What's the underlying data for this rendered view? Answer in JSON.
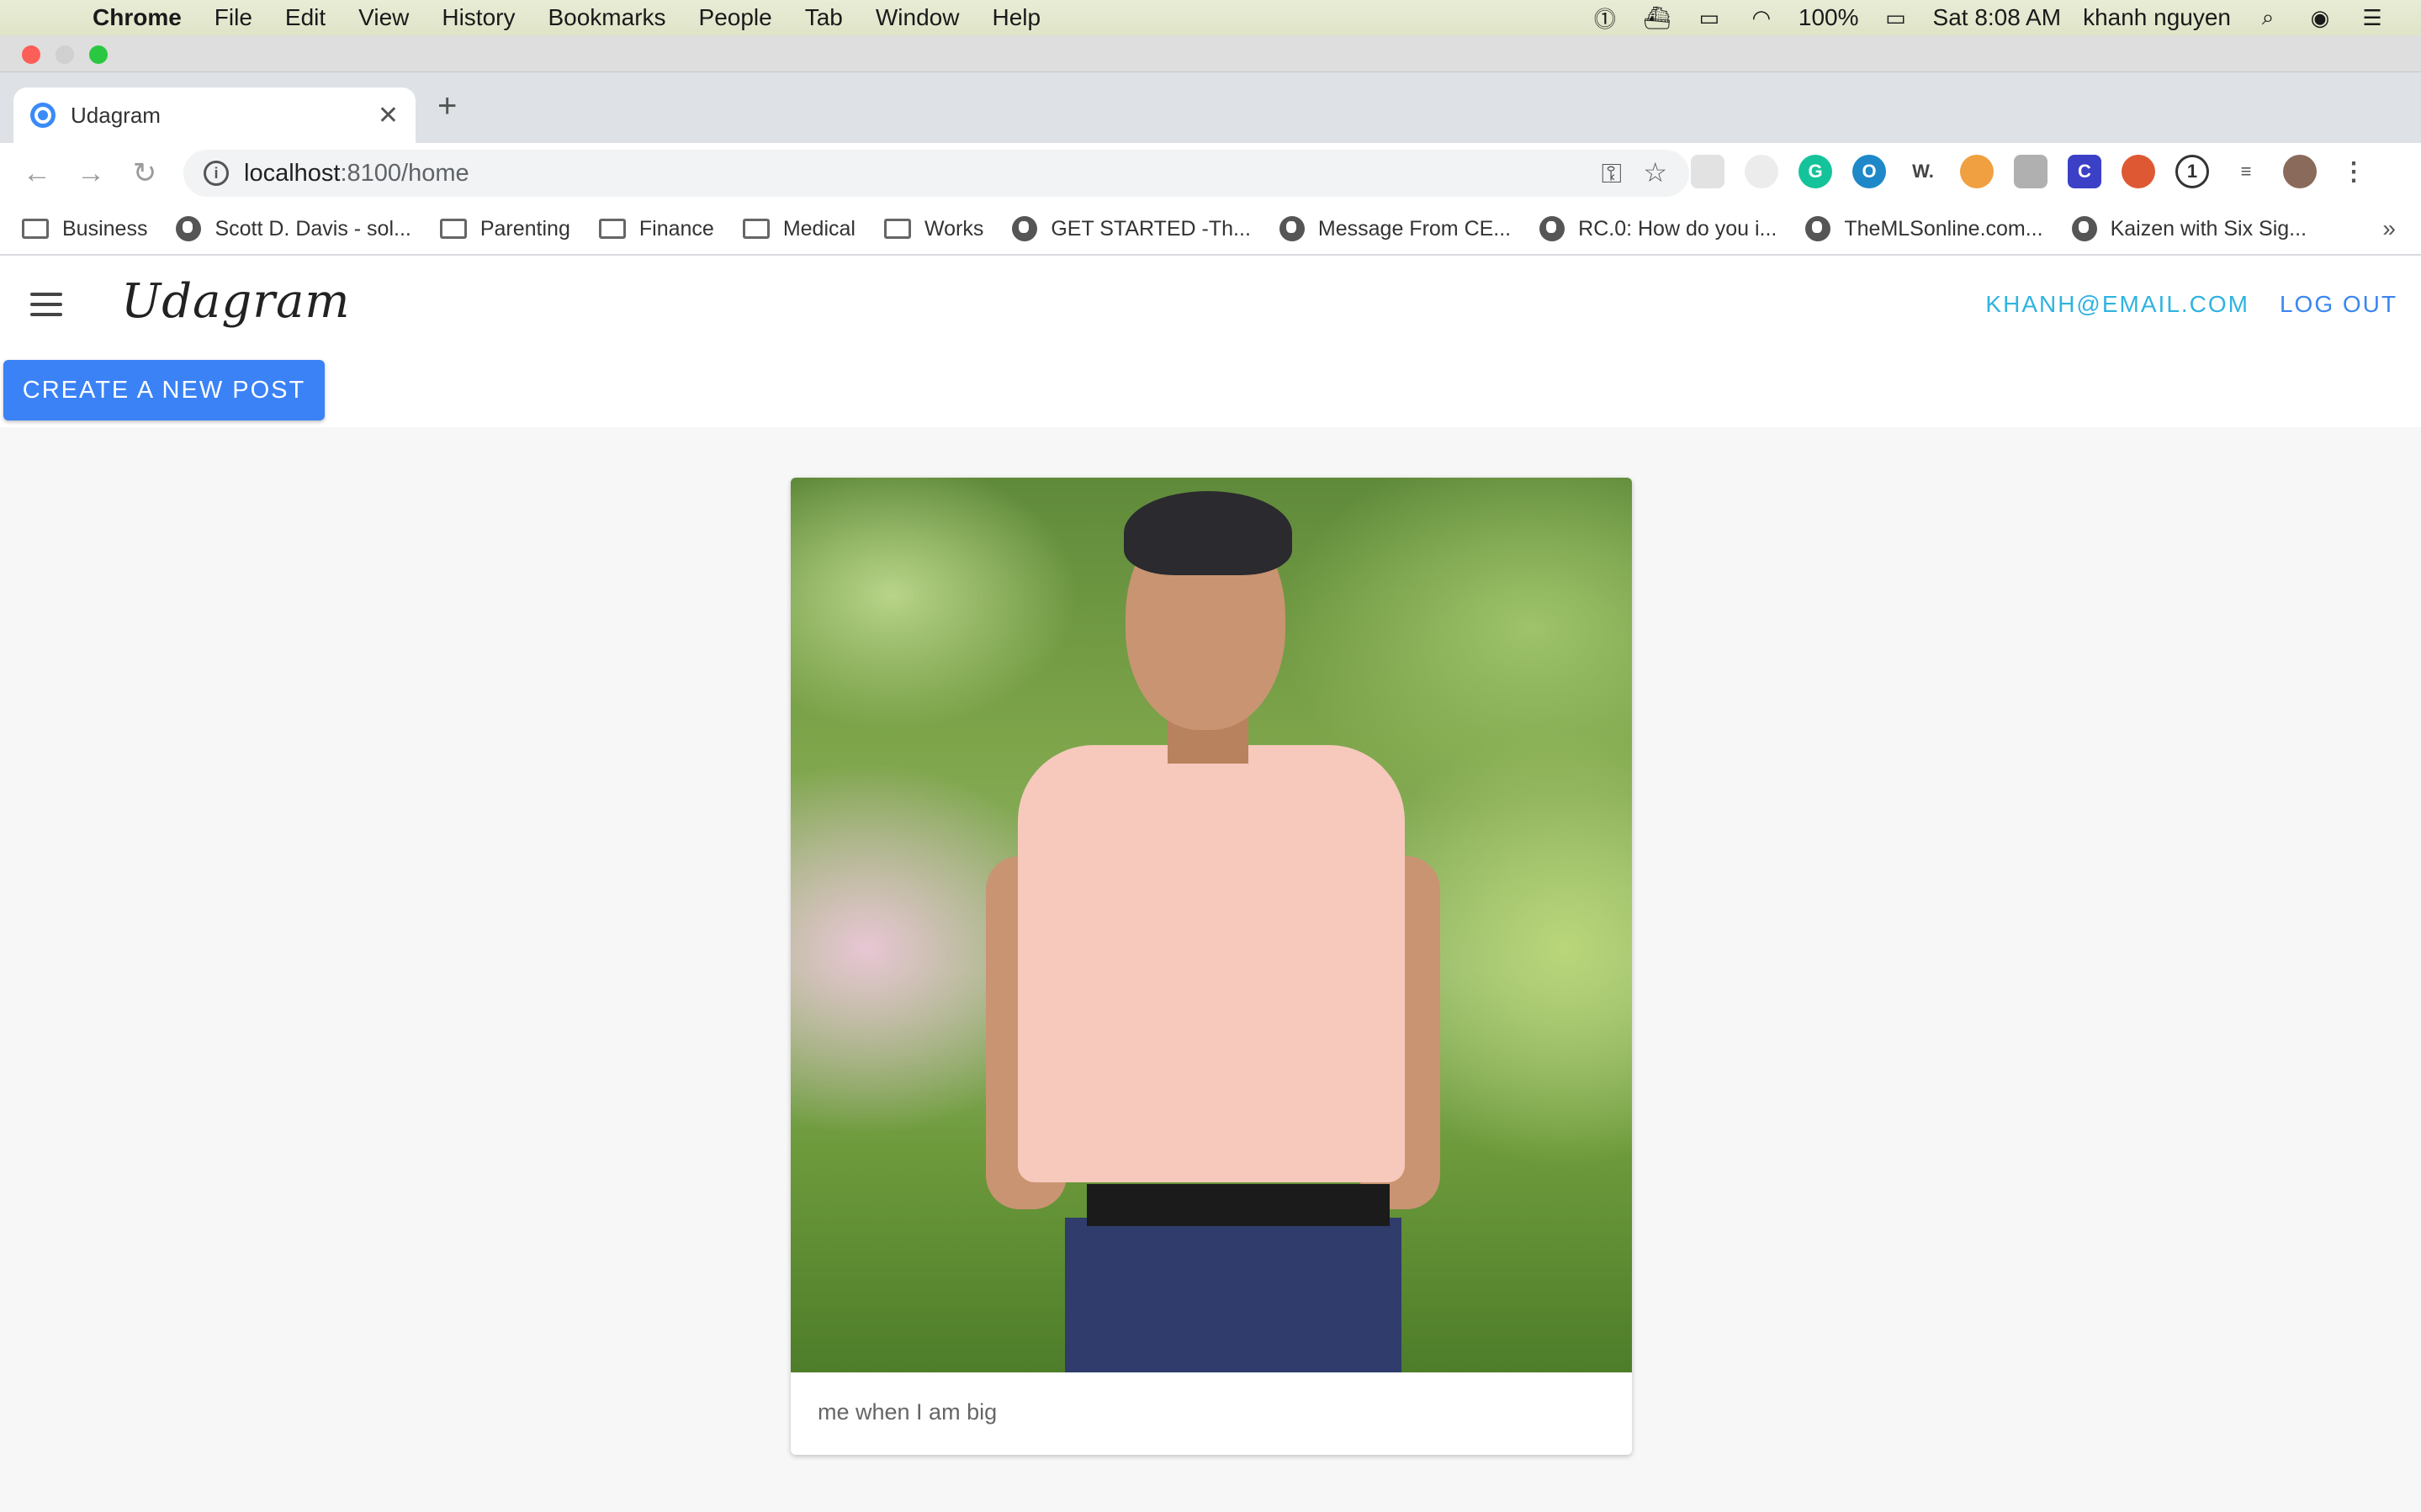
{
  "menubar": {
    "app_name": "Chrome",
    "items": [
      "File",
      "Edit",
      "View",
      "History",
      "Bookmarks",
      "People",
      "Tab",
      "Window",
      "Help"
    ],
    "battery": "100%",
    "clock": "Sat 8:08 AM",
    "user": "khanh nguyen"
  },
  "browser": {
    "tab_title": "Udagram",
    "url_host": "localhost",
    "url_path": ":8100/home",
    "bookmarks": [
      {
        "label": "Business",
        "icon": "folder-icon"
      },
      {
        "label": "Scott D. Davis - sol...",
        "icon": "globe-icon"
      },
      {
        "label": "Parenting",
        "icon": "folder-icon"
      },
      {
        "label": "Finance",
        "icon": "folder-icon"
      },
      {
        "label": "Medical",
        "icon": "folder-icon"
      },
      {
        "label": "Works",
        "icon": "folder-icon"
      },
      {
        "label": "GET STARTED -Th...",
        "icon": "globe-icon"
      },
      {
        "label": "Message From CE...",
        "icon": "globe-icon"
      },
      {
        "label": "RC.0: How do you i...",
        "icon": "globe-icon"
      },
      {
        "label": "TheMLSonline.com...",
        "icon": "globe-icon"
      },
      {
        "label": "Kaizen with Six Sig...",
        "icon": "globe-icon"
      }
    ]
  },
  "app": {
    "brand": "Udagram",
    "user_email": "KHANH@EMAIL.COM",
    "logout_label": "LOG OUT",
    "create_post_label": "CREATE A NEW POST"
  },
  "post": {
    "caption": "me when I am big"
  },
  "colors": {
    "primary_button": "#3a82f6",
    "email_link": "#2fb3e0",
    "logout_link": "#3a86f0"
  }
}
